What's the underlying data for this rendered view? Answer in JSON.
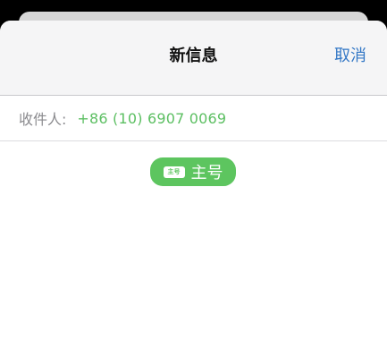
{
  "nav": {
    "title": "新信息",
    "cancel_label": "取消"
  },
  "recipient": {
    "label": "收件人:",
    "value": "+86 (10) 6907 0069"
  },
  "sim_line": {
    "icon_text": "主号",
    "label": "主号"
  },
  "colors": {
    "accent_blue": "#3478c6",
    "imessage_green": "#5dc55f",
    "recipient_green": "#5cbf62",
    "nav_background": "#f5f5f6"
  }
}
